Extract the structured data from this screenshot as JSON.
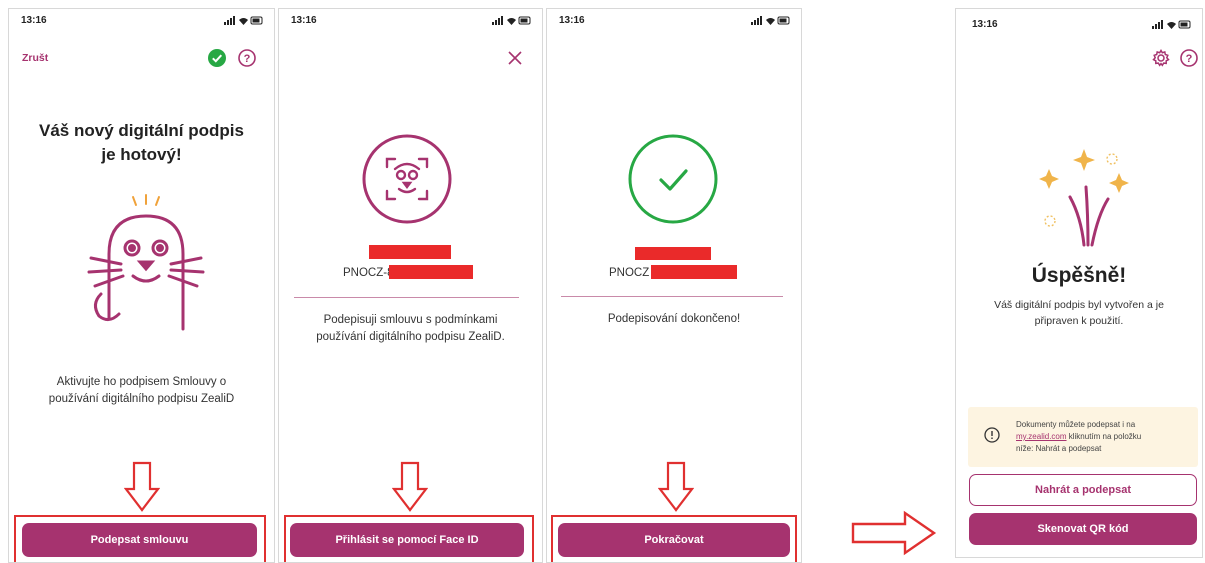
{
  "colors": {
    "brand": "#a6336f",
    "success": "#27a844",
    "annotation": "#e03030",
    "redaction": "#ea2a2a",
    "tip_bg": "#fdf4e1"
  },
  "screen1": {
    "time": "13:16",
    "cancel_label": "Zrušt",
    "title_line1": "Váš nový digitální podpis",
    "title_line2": "je hotový!",
    "body_line1": "Aktivujte ho podpisem Smlouvy o",
    "body_line2": "používání digitálního podpisu ZealiD",
    "button_label": "Podepsat smlouvu"
  },
  "screen2": {
    "time": "13:16",
    "id_prefix": "PNOCZ-8",
    "body_line1": "Podepisuji smlouvu s podmínkami",
    "body_line2": "používání digitálního podpisu ZealiD.",
    "button_label": "Přihlásit se pomocí Face ID"
  },
  "screen3": {
    "time": "13:16",
    "id_prefix": "PNOCZ",
    "body": "Podepisování dokončeno!",
    "button_label": "Pokračovat"
  },
  "screen4": {
    "time": "13:16",
    "title": "Úspěšně!",
    "body_line1": "Váš digitální podpis byl vytvořen a je",
    "body_line2": "připraven k použití.",
    "tip_line1": "Dokumenty můžete podepsat i na",
    "tip_link": "my.zealid.com",
    "tip_line2_rest": " kliknutím na položku",
    "tip_line3": "níže: Nahrát a podepsat",
    "secondary_button": "Nahrát a podepsat",
    "primary_button": "Skenovat QR kód"
  }
}
